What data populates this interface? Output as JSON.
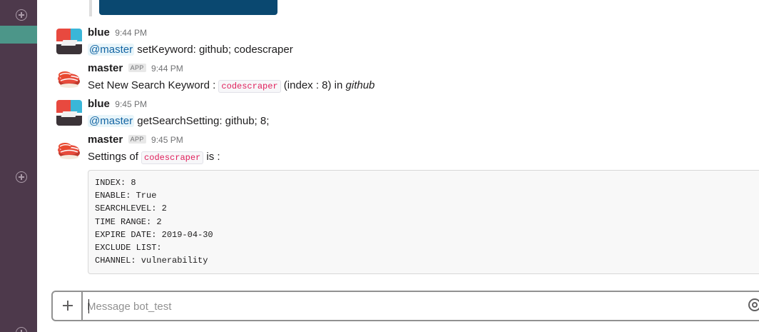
{
  "composer": {
    "placeholder": "Message bot_test"
  },
  "code_block": {
    "lines": [
      "INDEX: 8",
      "ENABLE: True",
      "SEARCHLEVEL: 2",
      "TIME RANGE: 2",
      "EXPIRE DATE: 2019-04-30",
      "EXCLUDE LIST:",
      "CHANNEL: vulnerability"
    ]
  },
  "messages": [
    {
      "author": "blue",
      "time": "9:44 PM",
      "mention": "@master",
      "text": "setKeyword: github; codescraper"
    },
    {
      "author": "master",
      "badge": "APP",
      "time": "9:44 PM",
      "text_before": "Set New Search Keyword : ",
      "code": "codescraper",
      "text_middle": " (index : 8) in ",
      "text_italic": "github"
    },
    {
      "author": "blue",
      "time": "9:45 PM",
      "mention": "@master",
      "text": "getSearchSetting: github; 8;"
    },
    {
      "author": "master",
      "badge": "APP",
      "time": "9:45 PM",
      "text_before": "Settings of ",
      "code": "codescraper",
      "text_after": " is :"
    }
  ]
}
